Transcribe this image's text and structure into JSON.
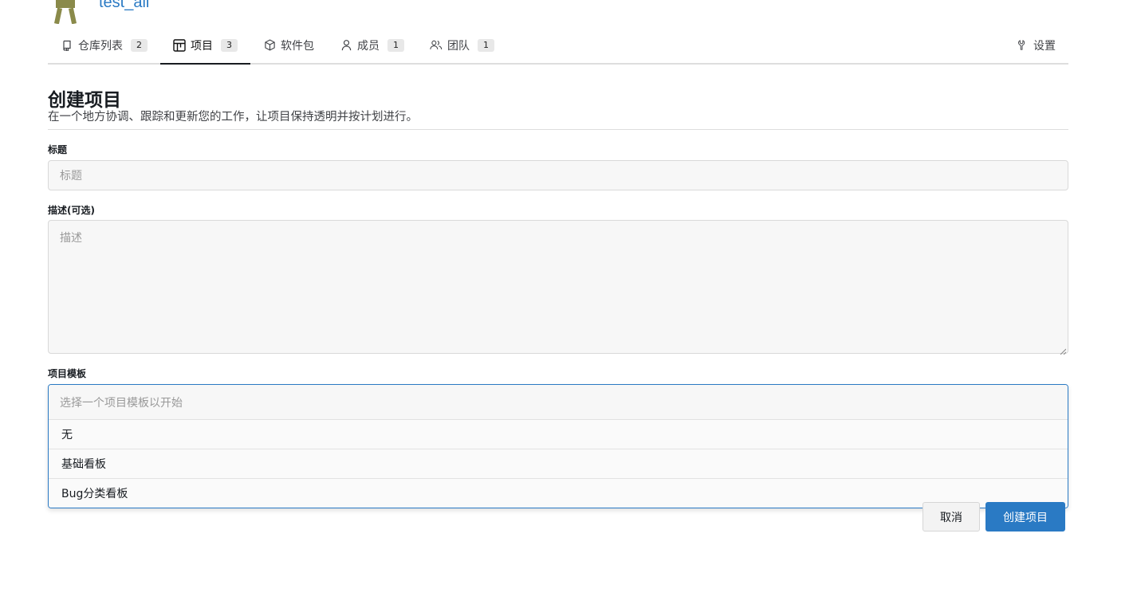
{
  "org": {
    "name": "test_all"
  },
  "tabs": [
    {
      "label": "仓库列表",
      "count": "2",
      "icon": "repo-icon"
    },
    {
      "label": "项目",
      "count": "3",
      "icon": "project-icon"
    },
    {
      "label": "软件包",
      "icon": "package-icon"
    },
    {
      "label": "成员",
      "count": "1",
      "icon": "person-icon"
    },
    {
      "label": "团队",
      "count": "1",
      "icon": "people-icon"
    },
    {
      "label": "设置",
      "icon": "tools-icon"
    }
  ],
  "form": {
    "heading": "创建项目",
    "description": "在一个地方协调、跟踪和更新您的工作，让项目保持透明并按计划进行。",
    "title_label": "标题",
    "title_placeholder": "标题",
    "desc_label": "描述(可选)",
    "desc_placeholder": "描述",
    "template_label": "项目模板",
    "template_placeholder": "选择一个项目模板以开始",
    "template_options": [
      "无",
      "基础看板",
      "Bug分类看板"
    ],
    "cancel_label": "取消",
    "create_label": "创建项目"
  },
  "colors": {
    "accent": "#2a7ac4",
    "avatar": "#8a8a4a"
  }
}
